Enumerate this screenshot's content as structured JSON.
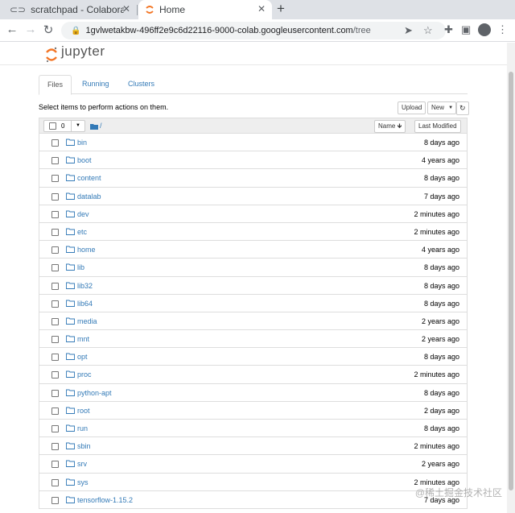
{
  "browser": {
    "tabs": [
      {
        "title": "scratchpad - Colaboratory",
        "active": false
      },
      {
        "title": "Home",
        "active": true
      }
    ],
    "new_tab": "+",
    "tab_close": "✕",
    "url_host": "1gvlwetakbw-496ff2e9c6d22116-9000-colab.googleusercontent.com",
    "url_path": "/tree"
  },
  "jupyter": {
    "logo_text": "jupyter",
    "tabs": [
      {
        "label": "Files",
        "active": true
      },
      {
        "label": "Running",
        "active": false
      },
      {
        "label": "Clusters",
        "active": false
      }
    ],
    "hint": "Select items to perform actions on them.",
    "upload_label": "Upload",
    "new_label": "New",
    "selected_count": "0",
    "breadcrumb": "/",
    "sort_name_label": "Name",
    "sort_modified_label": "Last Modified",
    "files": [
      {
        "name": "bin",
        "modified": "8 days ago"
      },
      {
        "name": "boot",
        "modified": "4 years ago"
      },
      {
        "name": "content",
        "modified": "8 days ago"
      },
      {
        "name": "datalab",
        "modified": "7 days ago"
      },
      {
        "name": "dev",
        "modified": "2 minutes ago"
      },
      {
        "name": "etc",
        "modified": "2 minutes ago"
      },
      {
        "name": "home",
        "modified": "4 years ago"
      },
      {
        "name": "lib",
        "modified": "8 days ago"
      },
      {
        "name": "lib32",
        "modified": "8 days ago"
      },
      {
        "name": "lib64",
        "modified": "8 days ago"
      },
      {
        "name": "media",
        "modified": "2 years ago"
      },
      {
        "name": "mnt",
        "modified": "2 years ago"
      },
      {
        "name": "opt",
        "modified": "8 days ago"
      },
      {
        "name": "proc",
        "modified": "2 minutes ago"
      },
      {
        "name": "python-apt",
        "modified": "8 days ago"
      },
      {
        "name": "root",
        "modified": "2 days ago"
      },
      {
        "name": "run",
        "modified": "8 days ago"
      },
      {
        "name": "sbin",
        "modified": "2 minutes ago"
      },
      {
        "name": "srv",
        "modified": "2 years ago"
      },
      {
        "name": "sys",
        "modified": "2 minutes ago"
      },
      {
        "name": "tensorflow-1.15.2",
        "modified": "7 days ago"
      }
    ]
  },
  "watermark": "@稀土掘金技术社区",
  "colors": {
    "link": "#337ab7",
    "logo_orange": "#f37626",
    "folder": "#337ab7"
  }
}
